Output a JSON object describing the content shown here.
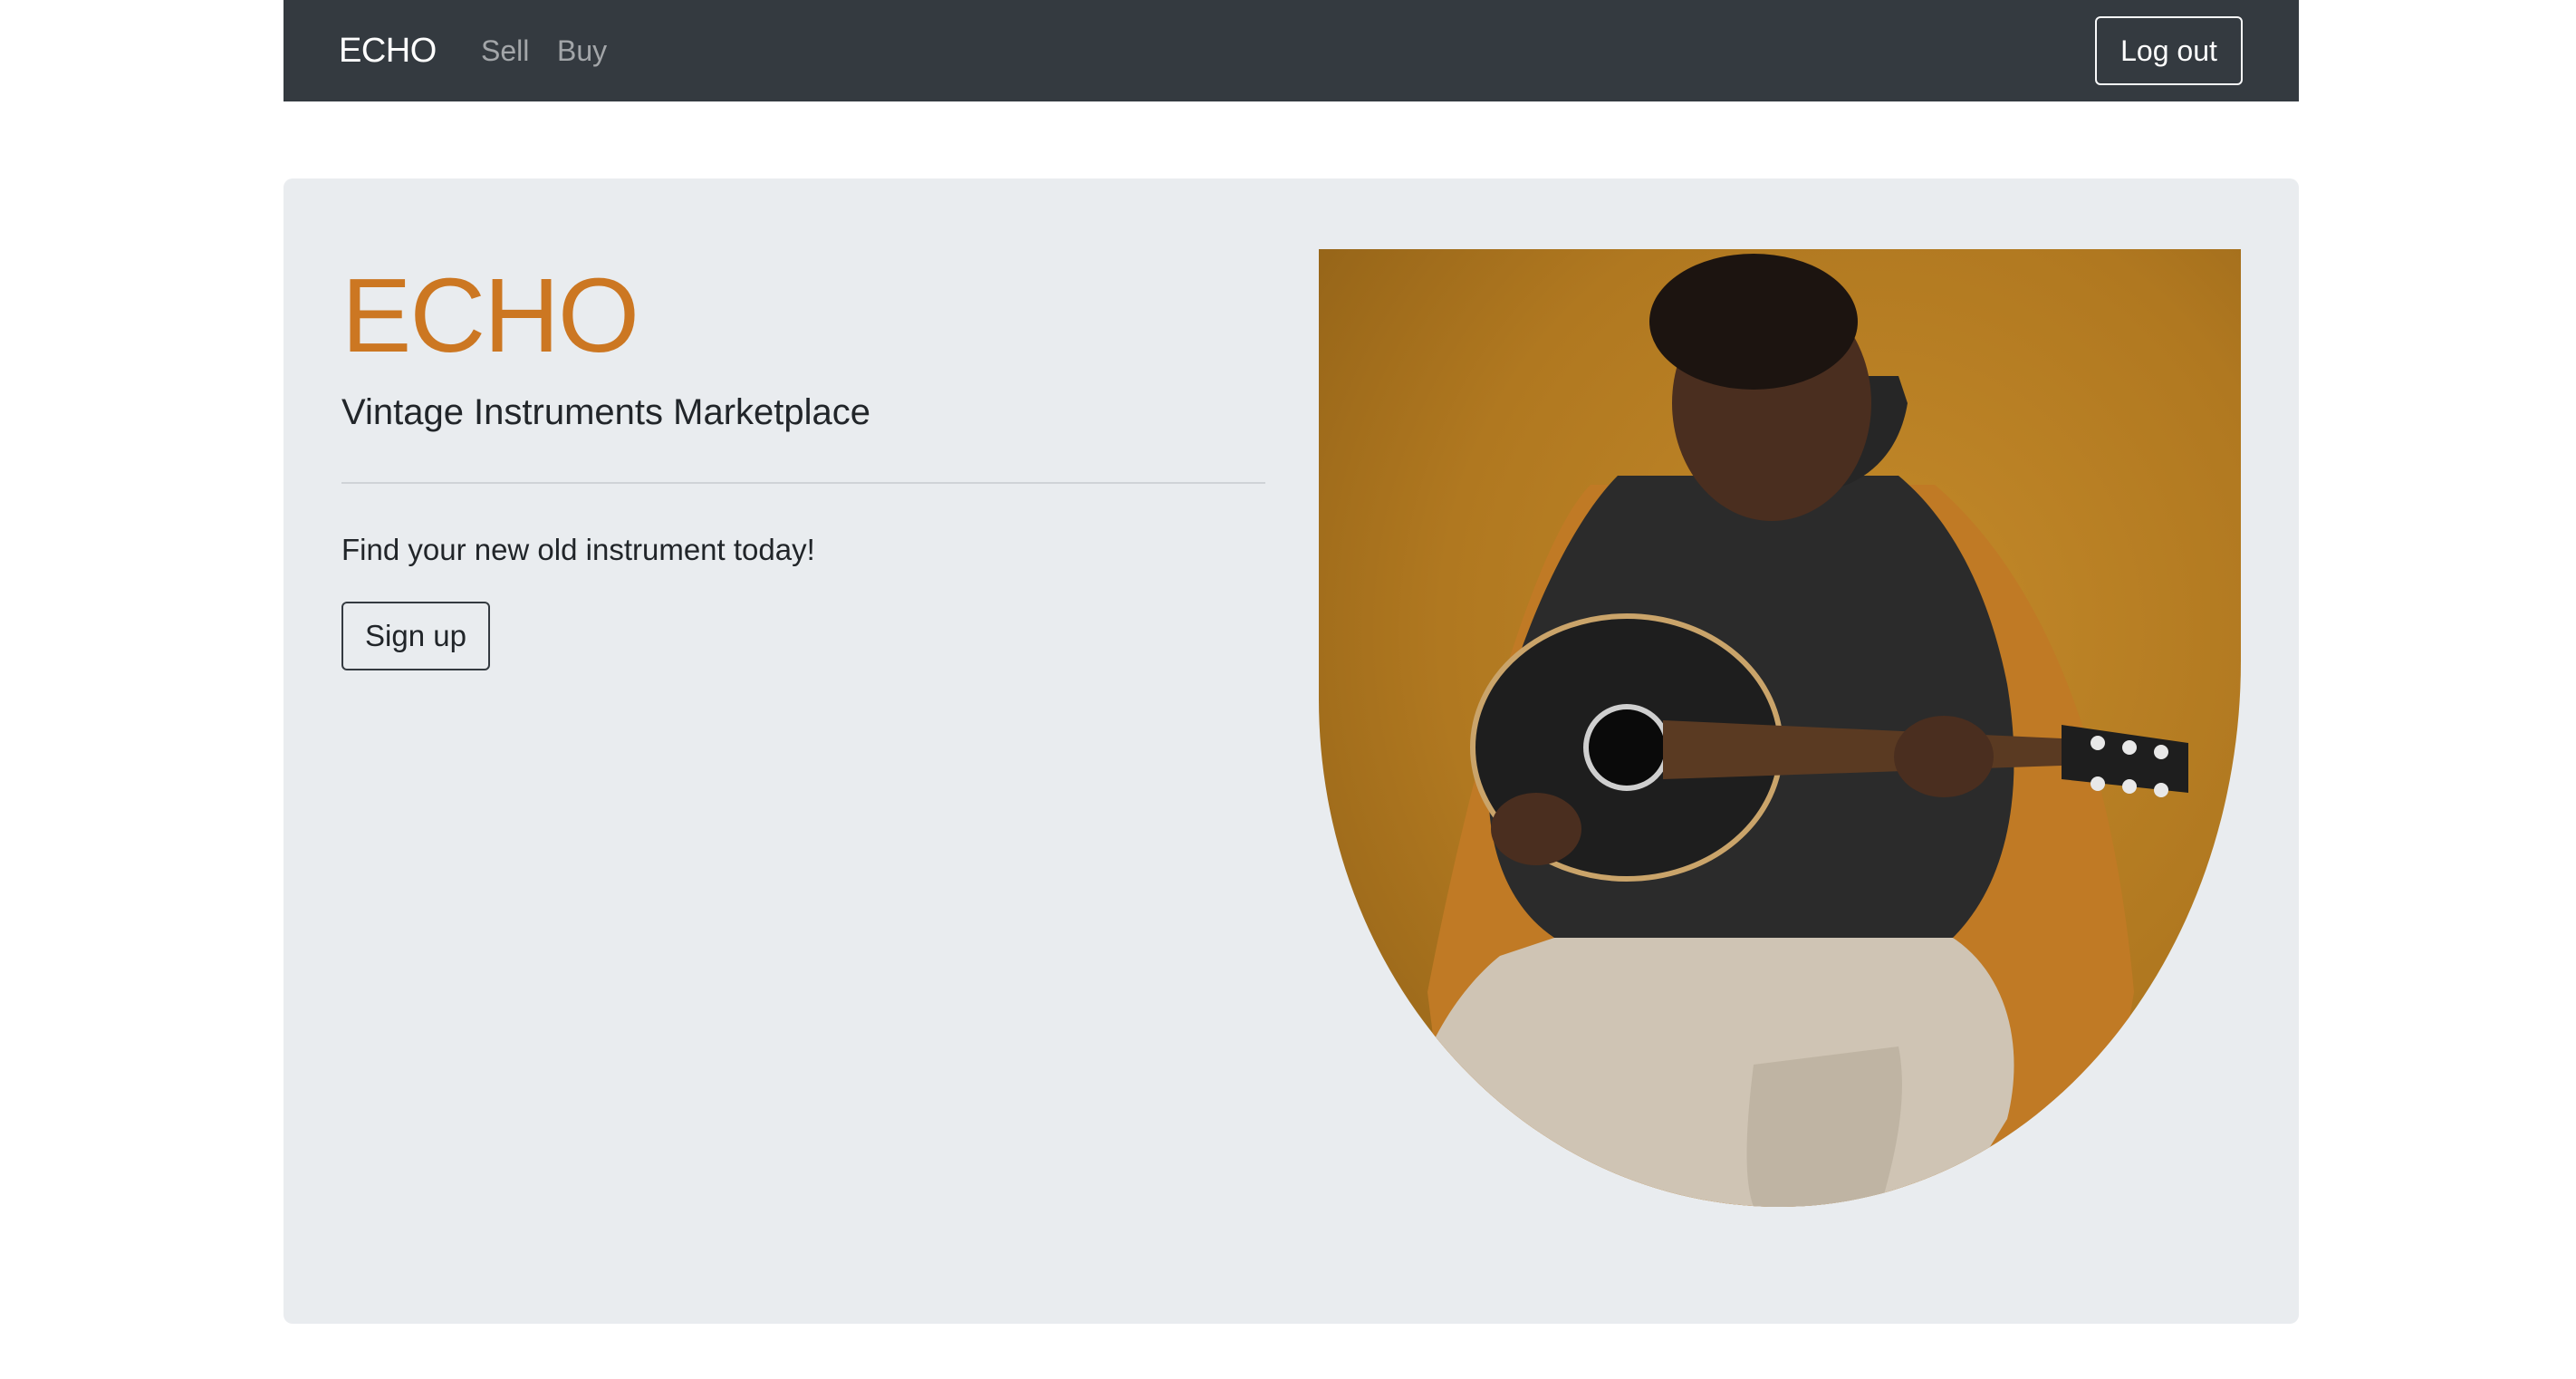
{
  "navbar": {
    "brand": "ECHO",
    "links": [
      {
        "label": "Sell"
      },
      {
        "label": "Buy"
      }
    ],
    "logout_label": "Log out"
  },
  "hero": {
    "title": "ECHO",
    "subtitle": "Vintage Instruments Marketplace",
    "tagline": "Find your new old instrument today!",
    "signup_label": "Sign up",
    "image_icon": "guitarist-photo"
  },
  "colors": {
    "navbar_bg": "#343a40",
    "accent": "#cc7722",
    "jumbotron_bg": "#e9ecef",
    "photo_bg": "#b07820"
  }
}
